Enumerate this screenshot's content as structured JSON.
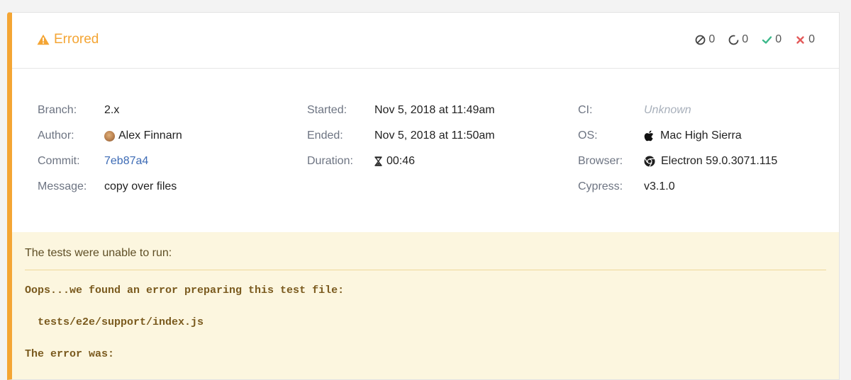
{
  "run": {
    "status": "Errored",
    "counts": {
      "skipped": "0",
      "pending": "0",
      "passed": "0",
      "failed": "0"
    }
  },
  "meta": {
    "branch_label": "Branch:",
    "branch": "2.x",
    "author_label": "Author:",
    "author": "Alex Finnarn",
    "commit_label": "Commit:",
    "commit": "7eb87a4",
    "message_label": "Message:",
    "message": "copy over files",
    "started_label": "Started:",
    "started": "Nov 5, 2018 at 11:49am",
    "ended_label": "Ended:",
    "ended": "Nov 5, 2018 at 11:50am",
    "duration_label": "Duration:",
    "duration": "00:46",
    "ci_label": "CI:",
    "ci": "Unknown",
    "os_label": "OS:",
    "os": "Mac High Sierra",
    "browser_label": "Browser:",
    "browser": "Electron 59.0.3071.115",
    "cypress_label": "Cypress:",
    "cypress": "v3.1.0"
  },
  "error": {
    "title": "The tests were unable to run:",
    "line1": "Oops...we found an error preparing this test file:",
    "line2": "  tests/e2e/support/index.js",
    "line3": "The error was:"
  },
  "colors": {
    "accent": "#f4a534",
    "link": "#3d6bb5",
    "passed": "#3bb88a",
    "failed": "#e35a5a",
    "error_bg": "#fcf6df"
  },
  "icons": [
    "warning-icon",
    "skipped-icon",
    "pending-icon",
    "check-icon",
    "x-icon",
    "hourglass-icon",
    "apple-icon",
    "chrome-icon"
  ]
}
